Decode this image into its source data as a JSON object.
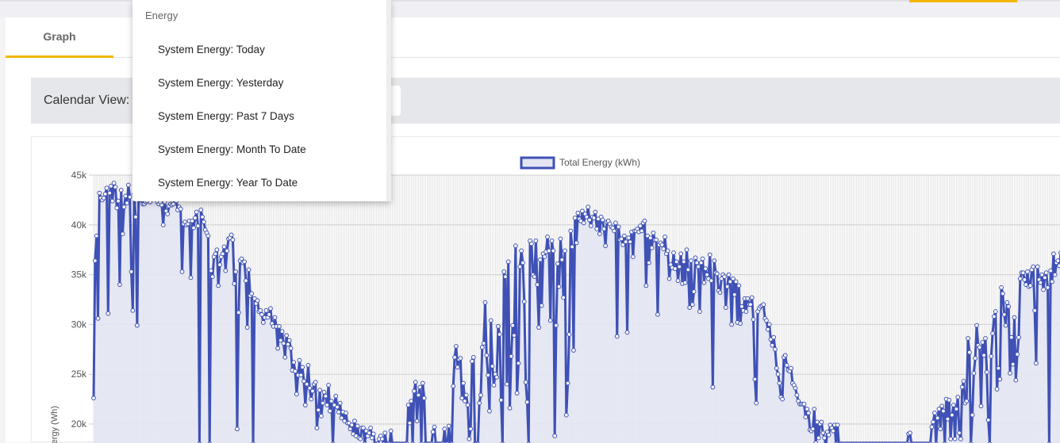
{
  "tabs": [
    {
      "label": "Graph"
    }
  ],
  "calendar": {
    "label": "Calendar View:"
  },
  "dropdown": {
    "header": "Energy",
    "items": [
      {
        "label": "System Energy: Today"
      },
      {
        "label": "System Energy: Yesterday"
      },
      {
        "label": "System Energy: Past 7 Days"
      },
      {
        "label": "System Energy: Month To Date"
      },
      {
        "label": "System Energy: Year To Date"
      }
    ]
  },
  "colors": {
    "accent": "#f2b705",
    "series_line": "#3f51b5",
    "series_fill": "#e3e5f2"
  },
  "chart_data": {
    "type": "line",
    "title": "",
    "xlabel": "",
    "ylabel": "Energy (Wh)",
    "y_ticks": [
      "45k",
      "40k",
      "35k",
      "30k",
      "25k",
      "20k"
    ],
    "ylim": [
      18000,
      45000
    ],
    "grid": true,
    "legend": {
      "position": "top-center",
      "entries": [
        "Total Energy (kWh)"
      ]
    },
    "series": [
      {
        "name": "Total Energy (kWh)",
        "values": [
          22600,
          36400,
          38900,
          30600,
          43200,
          42700,
          42500,
          42700,
          43100,
          43700,
          31100,
          43200,
          43900,
          42400,
          44200,
          43800,
          41700,
          42400,
          34000,
          43500,
          39100,
          41800,
          42900,
          42200,
          44000,
          42800,
          35300,
          31400,
          43100,
          40800,
          29900,
          42600,
          42500,
          42500,
          42100,
          42100,
          42300,
          42400,
          42700,
          42300,
          43200,
          42600,
          42800,
          43200,
          42300,
          42100,
          42300,
          42000,
          40000,
          42300,
          41400,
          41100,
          41900,
          42100,
          42000,
          42100,
          42600,
          42400,
          41500,
          41800,
          41600,
          35300,
          40100,
          40300,
          40000,
          40100,
          40400,
          34700,
          40400,
          39700,
          40700,
          41300,
          39900,
          18000,
          41500,
          40800,
          40300,
          39500,
          39200,
          38900,
          18000,
          35400,
          34800,
          36800,
          37100,
          37500,
          33900,
          36000,
          36800,
          37100,
          37800,
          35400,
          37400,
          38600,
          38700,
          39000,
          38500,
          34100,
          35300,
          19500,
          31200,
          36400,
          36600,
          36200,
          36300,
          34400,
          29700,
          35500,
          32900,
          33100,
          18000,
          32600,
          32100,
          32400,
          31300,
          31400,
          31000,
          30200,
          30700,
          31400,
          30700,
          31000,
          31600,
          30100,
          29800,
          30700,
          29800,
          27600,
          29800,
          28400,
          29300,
          28100,
          26700,
          28900,
          28000,
          28400,
          27600,
          25400,
          26200,
          25300,
          23000,
          24900,
          26400,
          24900,
          25700,
          24300,
          21900,
          24000,
          25900,
          23600,
          22500,
          23300,
          24000,
          24200,
          19600,
          21400,
          23400,
          20800,
          22100,
          23200,
          22800,
          21900,
          23900,
          21300,
          22300,
          18000,
          21900,
          22800,
          21700,
          21200,
          22100,
          20600,
          21200,
          20300,
          21100,
          20100,
          20100,
          19500,
          19900,
          19000,
          20300,
          18800,
          19800,
          18600,
          18500,
          19600,
          19600,
          18000,
          19300,
          18800,
          19100,
          19600,
          18600,
          19000,
          18000,
          18000,
          18000,
          18500,
          18800,
          18500,
          18000,
          19100,
          18000,
          18000,
          18000,
          19300,
          18000,
          18000,
          18000,
          18000,
          18000,
          18000,
          18000,
          18000,
          18000,
          18000,
          18000,
          21900,
          20100,
          22300,
          18000,
          23300,
          24200,
          20300,
          22900,
          23700,
          18000,
          24100,
          22600,
          18000,
          18000,
          18000,
          18000,
          18000,
          19200,
          19700,
          18000,
          18000,
          18000,
          18000,
          18000,
          18000,
          19500,
          18000,
          18000,
          19800,
          18000,
          18000,
          23800,
          26700,
          27800,
          25700,
          26500,
          26600,
          22600,
          24100,
          22300,
          22900,
          21900,
          18500,
          19500,
          26300,
          26700,
          18000,
          18000,
          18000,
          22100,
          22900,
          27700,
          28100,
          32200,
          26900,
          24900,
          21300,
          30400,
          25800,
          23900,
          25000,
          24700,
          29800,
          29000,
          22400,
          18000,
          35300,
          34800,
          24000,
          36300,
          21600,
          26800,
          29900,
          28900,
          37900,
          23100,
          26100,
          35800,
          37400,
          36200,
          32300,
          24200,
          22200,
          18000,
          38400,
          38100,
          35000,
          34800,
          38400,
          34000,
          29700,
          36500,
          31900,
          37100,
          36800,
          37300,
          38800,
          37400,
          30400,
          38400,
          37400,
          18800,
          29900,
          36100,
          33800,
          38600,
          36500,
          32700,
          37400,
          20900,
          24100,
          29000,
          39400,
          37800,
          27400,
          40700,
          38200,
          41200,
          40600,
          40400,
          41400,
          40200,
          41100,
          40800,
          41800,
          40500,
          39900,
          40800,
          40700,
          41300,
          39600,
          40600,
          39100,
          40800,
          40500,
          39600,
          37900,
          40300,
          40400,
          40100,
          39800,
          39700,
          39400,
          40200,
          28800,
          39800,
          38500,
          38600,
          38000,
          38900,
          38300,
          29200,
          38700,
          38300,
          39300,
          36800,
          39400,
          39400,
          39600,
          39300,
          39900,
          39400,
          40200,
          40400,
          33900,
          38900,
          36200,
          38700,
          37700,
          39200,
          38500,
          38500,
          31000,
          38000,
          38200,
          38000,
          37600,
          38800,
          37100,
          37400,
          34600,
          36000,
          35700,
          37200,
          35600,
          36300,
          34400,
          35800,
          37100,
          34100,
          36300,
          34200,
          37500,
          35500,
          31700,
          36400,
          32000,
          33300,
          36700,
          36200,
          35800,
          31300,
          36200,
          36600,
          34200,
          35600,
          35000,
          34600,
          37000,
          34400,
          23700,
          36400,
          35200,
          35100,
          33400,
          33200,
          34600,
          35000,
          34800,
          31700,
          33800,
          35000,
          34300,
          30000,
          34600,
          33000,
          34300,
          30200,
          33900,
          30100,
          31800,
          31400,
          32600,
          31300,
          32600,
          32000,
          32000,
          32700,
          30500,
          24500,
          22100,
          31300,
          31600,
          31800,
          31900,
          32000,
          30600,
          30400,
          29500,
          30000,
          28500,
          27900,
          28700,
          27500,
          25600,
          25000,
          24100,
          22700,
          22500,
          26700,
          26900,
          25900,
          25400,
          25300,
          25600,
          24100,
          23900,
          23600,
          22900,
          22300,
          22000,
          22000,
          22000,
          22000,
          20700,
          21500,
          21100,
          19400,
          19300,
          19500,
          21500,
          18100,
          20200,
          18600,
          20000,
          20200,
          19100,
          18600,
          17800,
          19200,
          18900,
          19900,
          19600,
          19300,
          19900,
          18000,
          19900,
          18000,
          18000,
          18000,
          18000,
          18000,
          18000,
          18000,
          18000,
          18000,
          18000,
          18000,
          18000,
          18000,
          18000,
          18000,
          18000,
          18000,
          18000,
          18000,
          18000,
          18000,
          18000,
          18000,
          18000,
          18000,
          18000,
          18000,
          18000,
          18000,
          18000,
          18000,
          18000,
          18000,
          18000,
          18000,
          18000,
          18000,
          18000,
          18000,
          18000,
          18000,
          18000,
          18000,
          18000,
          18000,
          18000,
          18000,
          18000,
          19000,
          19100,
          18000,
          18000,
          18000,
          18000,
          18000,
          18000,
          18000,
          18000,
          18000,
          18000,
          18000,
          18000,
          18000,
          18000,
          19700,
          20200,
          21100,
          18000,
          20600,
          21500,
          19500,
          21800,
          21300,
          18000,
          22500,
          20500,
          22400,
          18500,
          20900,
          21900,
          18500,
          21500,
          22700,
          19100,
          18500,
          23700,
          24300,
          22100,
          22300,
          28600,
          27200,
          18000,
          20900,
          25100,
          26600,
          29900,
          27900,
          27700,
          21800,
          28200,
          26900,
          28600,
          25200,
          20400,
          18000,
          26800,
          29100,
          30800,
          31300,
          23500,
          25600,
          24500,
          33700,
          33100,
          31000,
          29900,
          32200,
          31800,
          25100,
          28700,
          26000,
          30700,
          24400,
          27000,
          28700,
          34600,
          35200,
          35200,
          34500,
          34000,
          35300,
          33800,
          33900,
          35500,
          35800,
          31400,
          26100,
          35800,
          34500,
          34200,
          35000,
          33500,
          34700,
          35200,
          33700,
          18000,
          35400,
          34300,
          37100,
          35000,
          36200,
          36400,
          35900,
          37200
        ]
      }
    ]
  }
}
